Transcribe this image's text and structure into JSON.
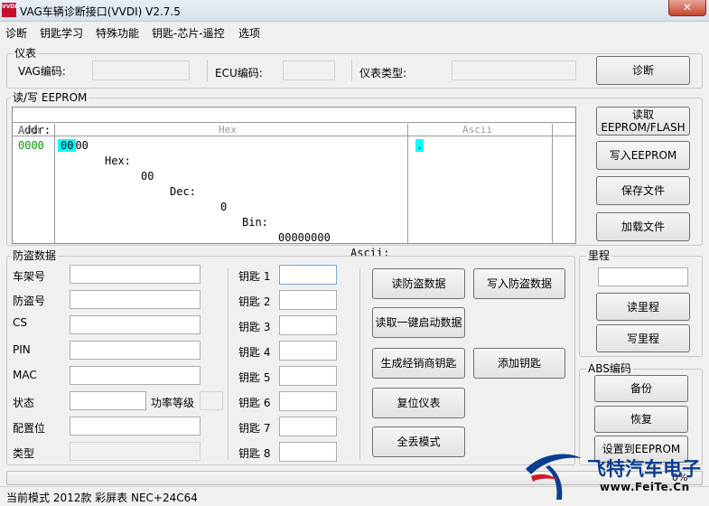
{
  "window": {
    "title": "VAG车辆诊断接口(VVDI)  V2.7.5",
    "logo_text": "VVDI",
    "close_glyph": "✕"
  },
  "menu": [
    "诊断",
    "钥匙学习",
    "特殊功能",
    "钥匙-芯片-遥控",
    "选项"
  ],
  "instrument": {
    "group_label": "仪表",
    "vag_code_label": "VAG编码:",
    "ecu_code_label": "ECU编码:",
    "type_label": "仪表类型:",
    "vag_code_value": "",
    "ecu_code_value": "",
    "type_value": "",
    "diagnose_button": "诊断"
  },
  "eeprom": {
    "group_label": "读/写 EEPROM",
    "status": {
      "addr_label": "Addr:",
      "addr_value": "0000",
      "hex_label": "Hex:",
      "hex_value": "00",
      "dec_label": "Dec:",
      "dec_value": "0",
      "bin_label": "Bin:",
      "bin_value": "00000000",
      "ascii_label": "Ascii:",
      "ascii_value": "."
    },
    "columns": {
      "addr": "Addr",
      "hex": "Hex",
      "ascii": "Ascii"
    },
    "rows": [
      {
        "addr": "0000",
        "hex": "00",
        "ascii": "."
      }
    ],
    "highlight_color": "#00ffff",
    "addr_color": "#00a000",
    "buttons": {
      "read": "读取\nEEPROM/FLASH",
      "write": "写入EEPROM",
      "save": "保存文件",
      "load": "加载文件"
    }
  },
  "immo": {
    "group_label": "防盗数据",
    "fields": [
      {
        "label": "车架号",
        "value": ""
      },
      {
        "label": "防盗号",
        "value": ""
      },
      {
        "label": "CS",
        "value": ""
      },
      {
        "label": "PIN",
        "value": ""
      },
      {
        "label": "MAC",
        "value": ""
      },
      {
        "label": "状态",
        "value": ""
      },
      {
        "label": "配置位",
        "value": ""
      },
      {
        "label": "类型",
        "value": ""
      }
    ],
    "power_label": "功率等级",
    "power_value": "",
    "keys": [
      {
        "label": "钥匙 1",
        "value": ""
      },
      {
        "label": "钥匙 2",
        "value": ""
      },
      {
        "label": "钥匙 3",
        "value": ""
      },
      {
        "label": "钥匙 4",
        "value": ""
      },
      {
        "label": "钥匙 5",
        "value": ""
      },
      {
        "label": "钥匙 6",
        "value": ""
      },
      {
        "label": "钥匙 7",
        "value": ""
      },
      {
        "label": "钥匙 8",
        "value": ""
      }
    ],
    "buttons": {
      "read_immo": "读防盗数据",
      "write_immo": "写入防盗数据",
      "one_key_read": "读取一键启动数据",
      "gen_dealer_key": "生成经销商钥匙",
      "add_key": "添加钥匙",
      "reset_cluster": "复位仪表",
      "all_keys_lost": "全丢模式"
    }
  },
  "mileage": {
    "group_label": "里程",
    "value": "",
    "read_button": "读里程",
    "write_button": "写里程"
  },
  "abs": {
    "group_label": "ABS编码",
    "backup_button": "备份",
    "restore_button": "恢复",
    "set_eeprom_button": "设置到EEPROM"
  },
  "progress": {
    "percent_text": "0%",
    "value": 0
  },
  "status_bar": {
    "text": "当前模式 2012款 彩屏表 NEC+24C64"
  },
  "watermark": {
    "brand": "飞特汽车电子",
    "url": "www.FeiTe.Cn"
  }
}
